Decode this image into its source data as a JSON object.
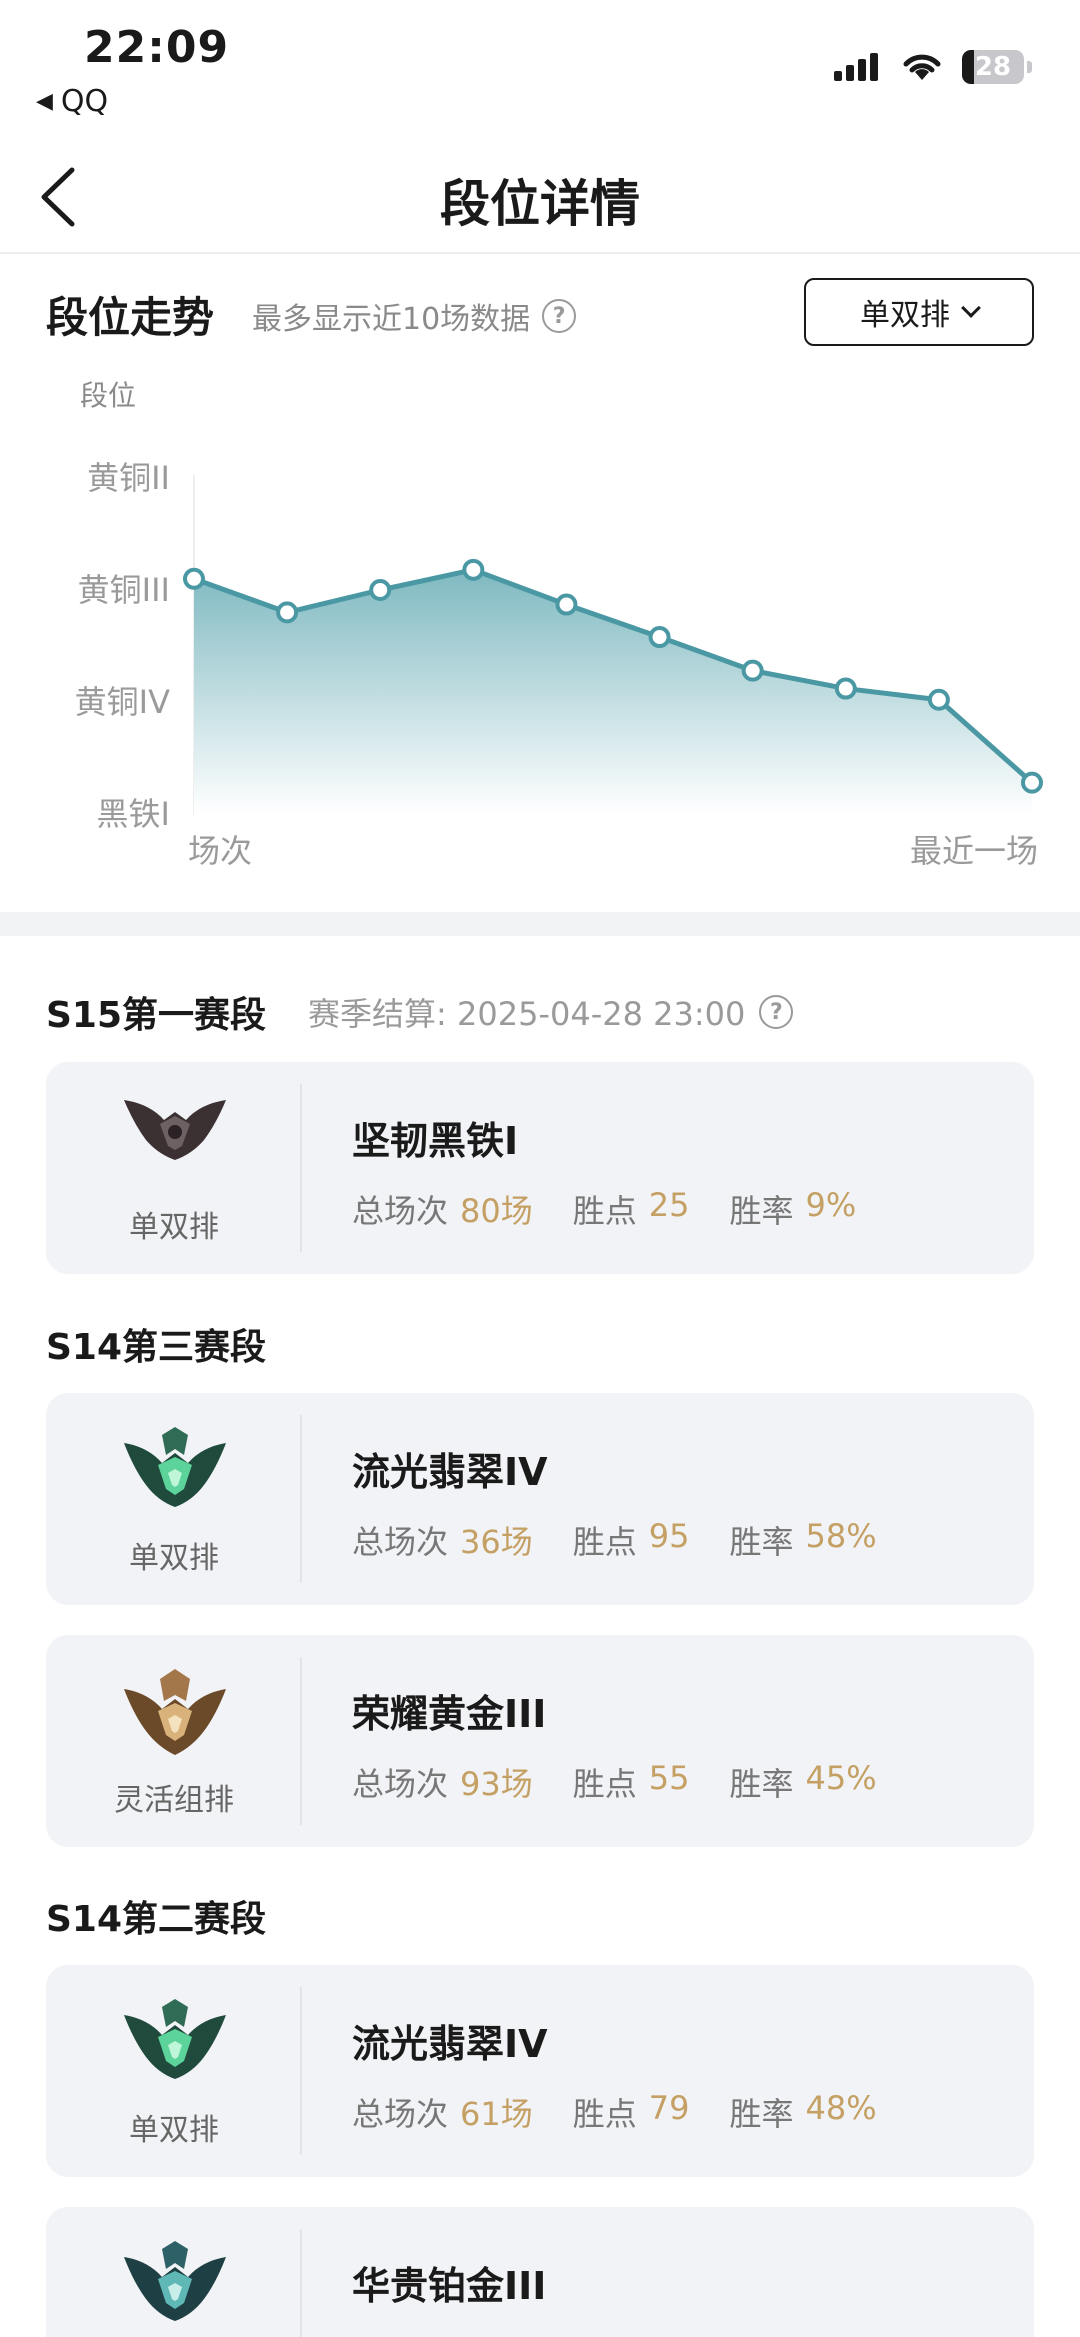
{
  "status_bar": {
    "time": "22:09",
    "back_app": "QQ",
    "battery": "28"
  },
  "nav": {
    "title": "段位详情"
  },
  "trend": {
    "title": "段位走势",
    "subtitle": "最多显示近10场数据",
    "queue_select": "单双排"
  },
  "chart_data": {
    "type": "area",
    "ylabel": "段位",
    "ytick_labels": [
      "黑铁I",
      "黄铜IV",
      "黄铜III",
      "黄铜II"
    ],
    "y_range": [
      0,
      3
    ],
    "x_start_label": "场次",
    "x_end_label": "最近一场",
    "values": [
      2.1,
      1.8,
      2.0,
      2.18,
      1.87,
      1.58,
      1.28,
      1.12,
      1.02,
      0.28
    ],
    "colors": {
      "line": "#4a98a3",
      "fill_top": "#7fb9c1",
      "fill_bottom": "#ffffff",
      "marker_fill": "#ffffff"
    }
  },
  "seasons": [
    {
      "name": "S15第一赛段",
      "note_label": "赛季结算: 2025-04-28 23:00",
      "cards": [
        {
          "queue": "单双排",
          "rank": "坚韧黑铁I",
          "emblem": "iron-emblem-icon",
          "games_label": "总场次",
          "games": "80场",
          "lp_label": "胜点",
          "lp": "25",
          "wr_label": "胜率",
          "wr": "9%"
        }
      ]
    },
    {
      "name": "S14第三赛段",
      "cards": [
        {
          "queue": "单双排",
          "rank": "流光翡翠IV",
          "emblem": "emerald-emblem-icon",
          "games_label": "总场次",
          "games": "36场",
          "lp_label": "胜点",
          "lp": "95",
          "wr_label": "胜率",
          "wr": "58%"
        },
        {
          "queue": "灵活组排",
          "rank": "荣耀黄金III",
          "emblem": "gold-emblem-icon",
          "games_label": "总场次",
          "games": "93场",
          "lp_label": "胜点",
          "lp": "55",
          "wr_label": "胜率",
          "wr": "45%"
        }
      ]
    },
    {
      "name": "S14第二赛段",
      "cards": [
        {
          "queue": "单双排",
          "rank": "流光翡翠IV",
          "emblem": "emerald-emblem-icon",
          "games_label": "总场次",
          "games": "61场",
          "lp_label": "胜点",
          "lp": "79",
          "wr_label": "胜率",
          "wr": "48%"
        },
        {
          "rank": "华贵铂金III",
          "emblem": "platinum-emblem-icon"
        }
      ]
    }
  ]
}
